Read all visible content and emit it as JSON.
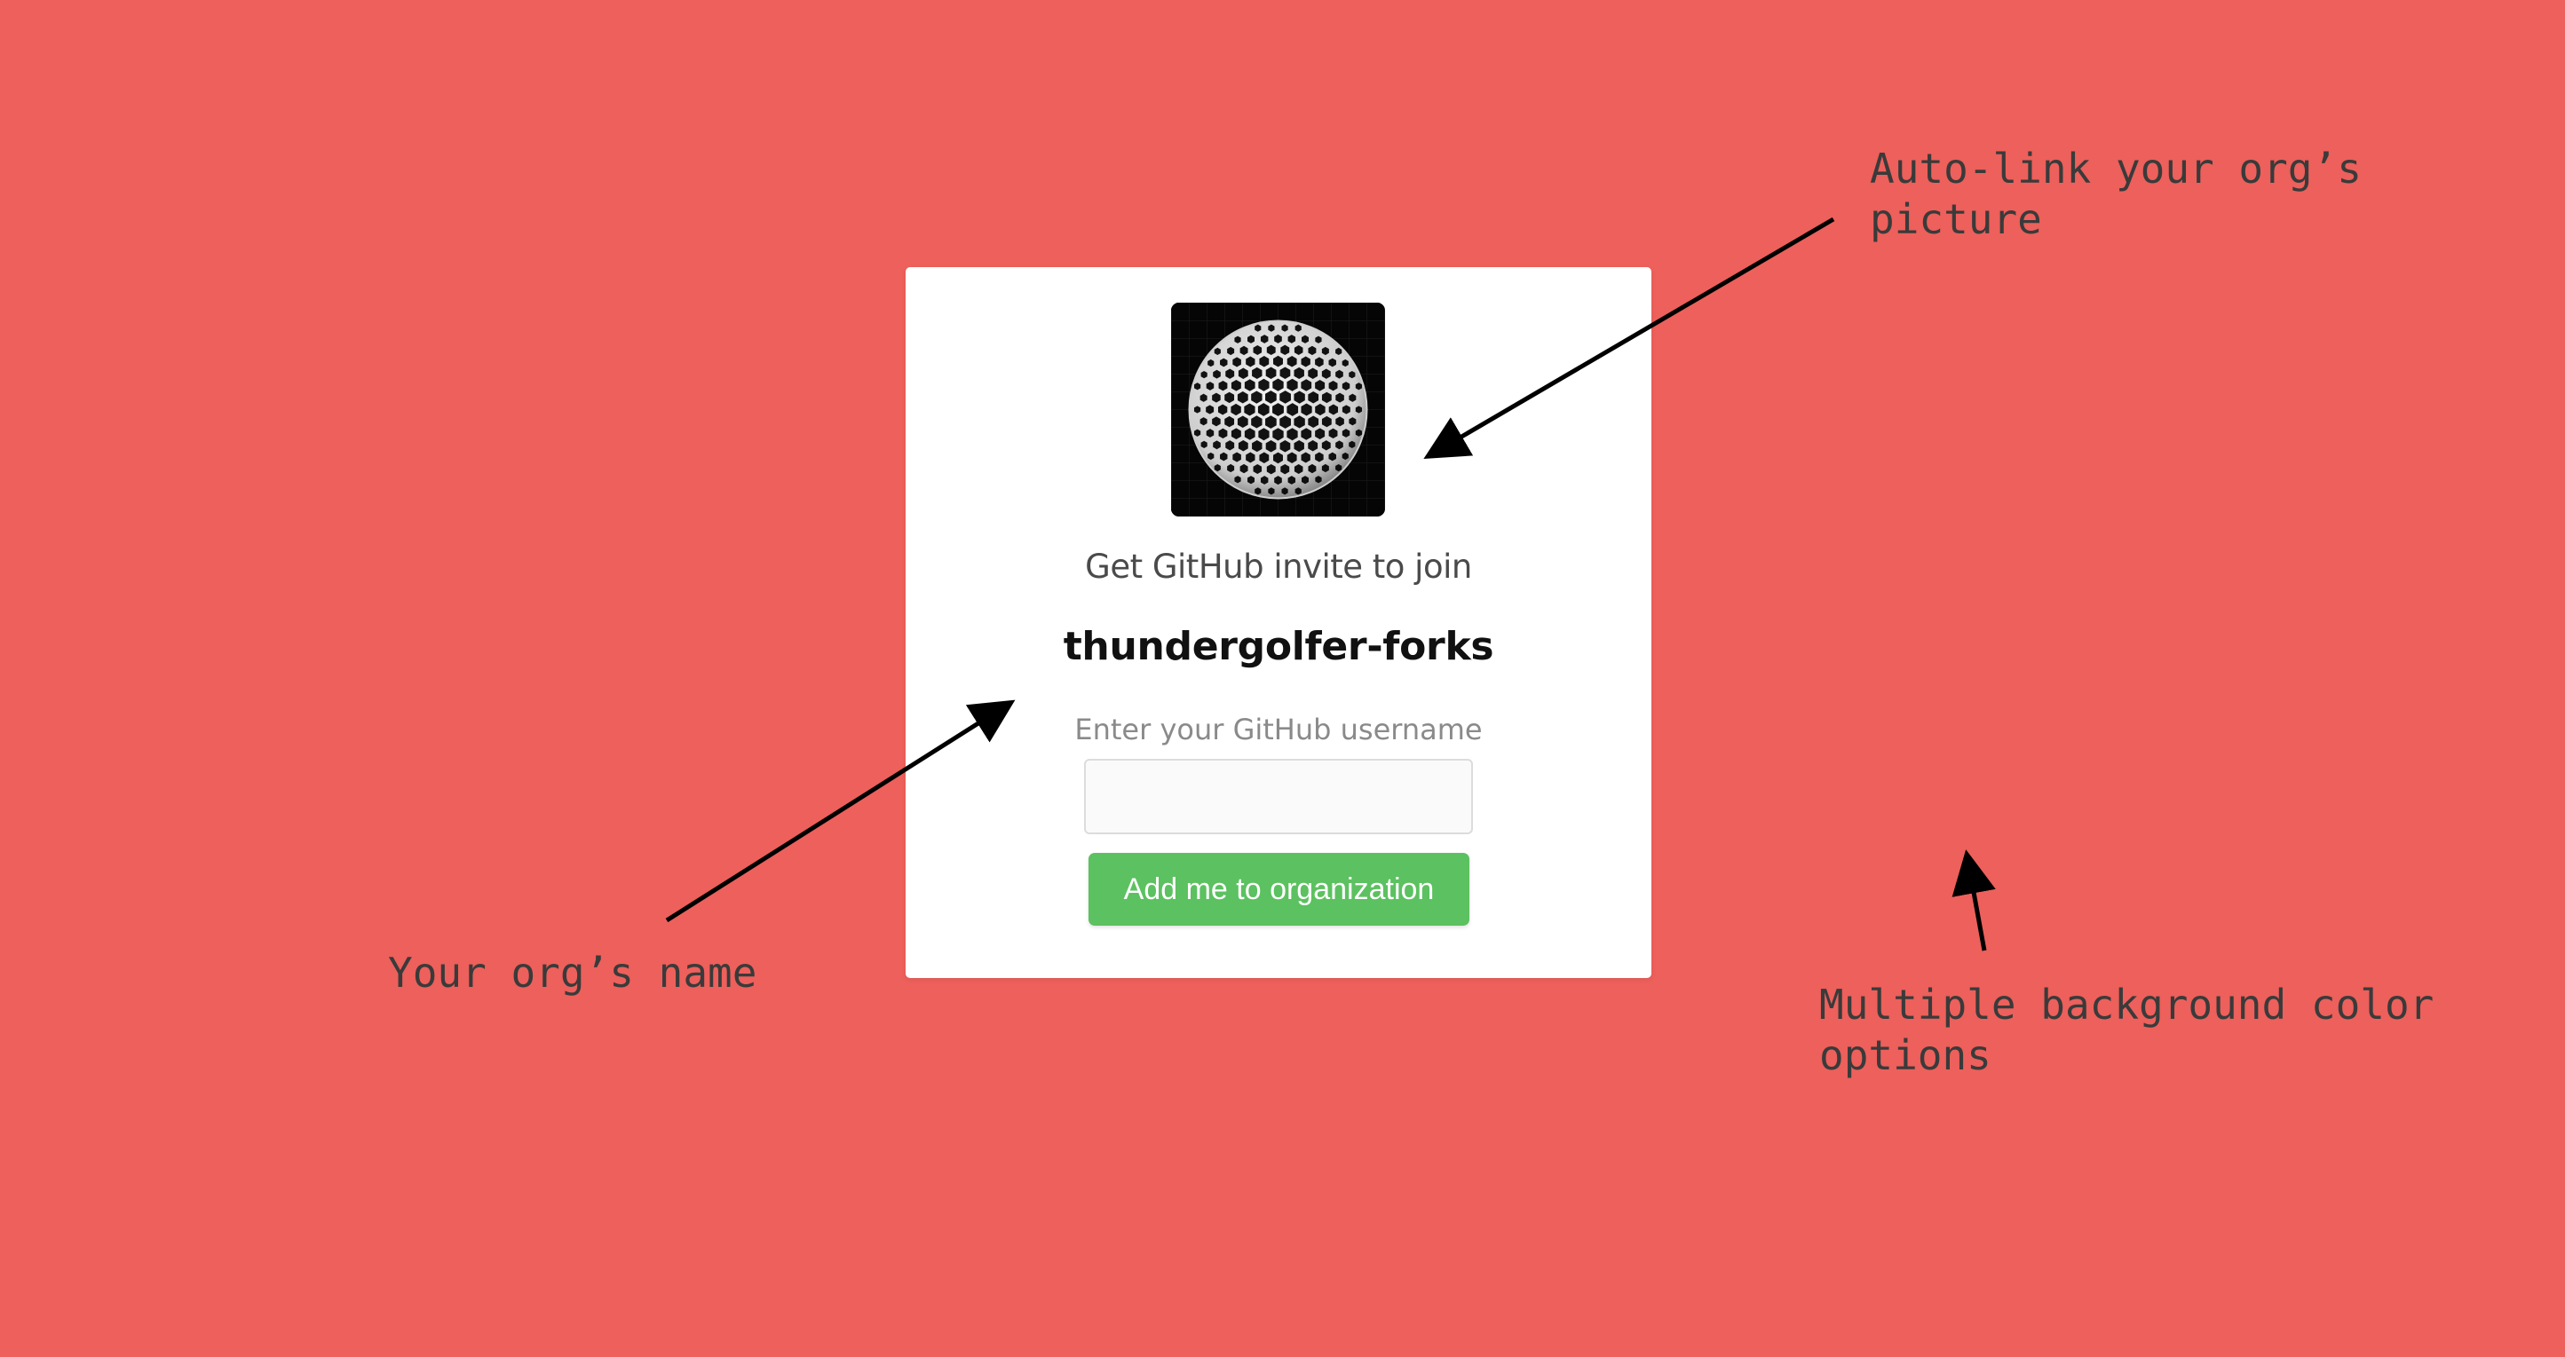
{
  "page": {
    "background_color": "#ED605B"
  },
  "card": {
    "avatar_alt": "organization avatar",
    "invite_text": "Get GitHub invite to join",
    "org_name": "thundergolfer-forks",
    "username_label": "Enter your GitHub username",
    "username_value": "",
    "username_placeholder": "",
    "submit_label": "Add me to organization",
    "button_color": "#5CC160"
  },
  "annotations": {
    "picture_note": "Auto-link your org’s\npicture",
    "name_note": "Your org’s name",
    "background_note": "Multiple background color\noptions"
  }
}
